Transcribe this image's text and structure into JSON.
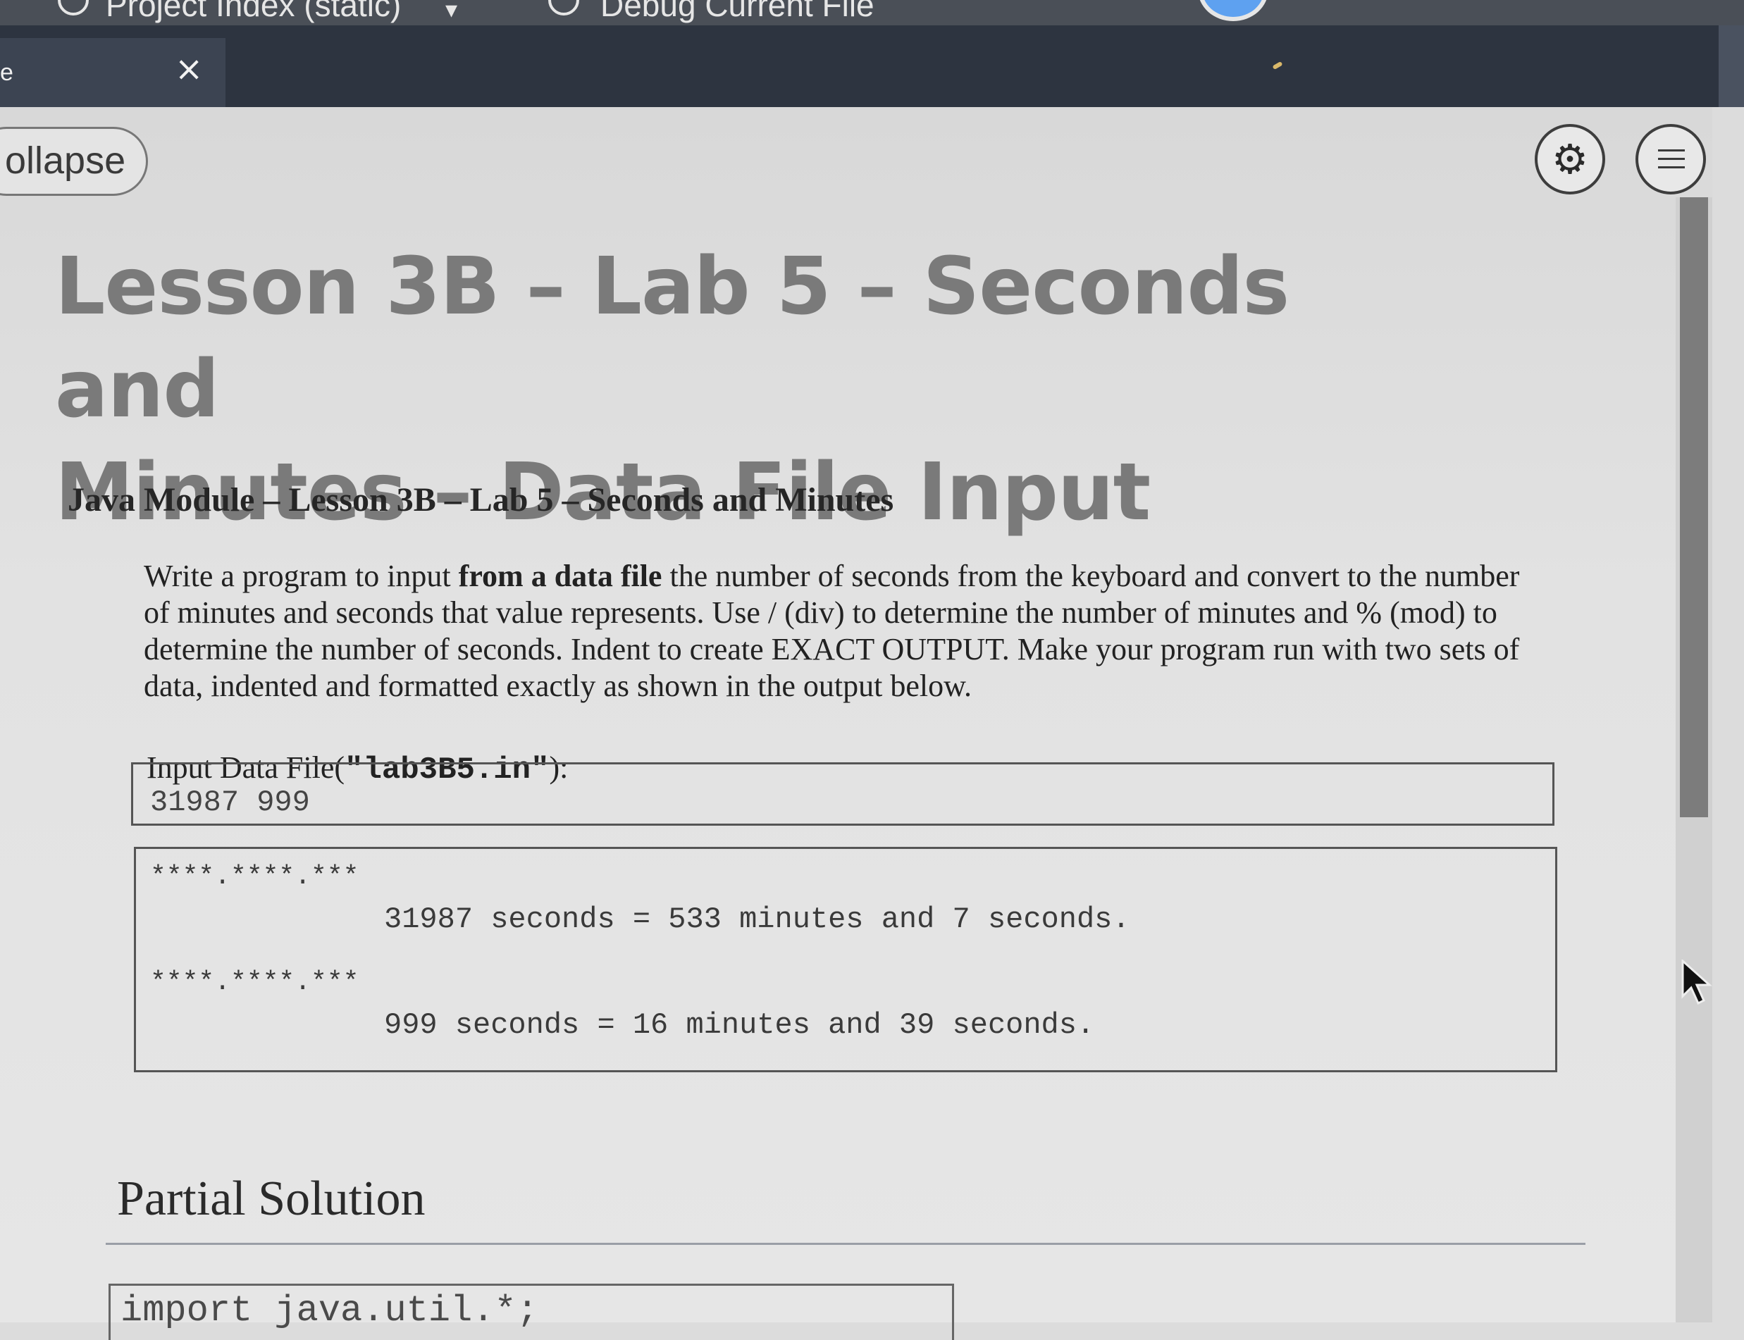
{
  "toolbar": {
    "project_index_label": "Project Index (static)",
    "debug_label": "Debug Current File",
    "globe_icon": "globe-icon",
    "debug_icon": "bug-icon",
    "dropdown_icon": "chevron-down-icon"
  },
  "tab": {
    "label": "e",
    "close_glyph": "×"
  },
  "controls": {
    "collapse_label": "ollapse",
    "gear_glyph": "⚙",
    "gear_icon": "gear-icon",
    "menu_icon": "list-icon"
  },
  "lesson": {
    "title_line1": "Lesson 3B – Lab 5 – Seconds and",
    "title_line2": "Minutes – Data File Input",
    "subtitle": "Java Module – Lesson 3B – Lab 5 – Seconds and Minutes",
    "description": {
      "part1": "Write a program to input ",
      "bold": "from a data file",
      "part2": " the number of seconds from the keyboard and convert to the number of minutes and seconds that value represents. Use / (div) to determine the number of minutes and % (mod) to determine the number of seconds. Indent to create EXACT OUTPUT. Make your program run with two sets of data, indented and formatted exactly as shown in the output below."
    }
  },
  "input_file": {
    "label_prefix": "Input Data File(",
    "file_name": "\"lab3B5.in\"",
    "label_suffix": "):",
    "contents": "31987 999"
  },
  "output": {
    "ruler1": "****.****.***",
    "line1": "31987 seconds = 533 minutes and 7 seconds.",
    "ruler2": "****.****.***",
    "line2": "999 seconds = 16 minutes and 39 seconds."
  },
  "partial_solution": {
    "heading": "Partial Solution",
    "code_first_line": "import java.util.*;"
  },
  "colors": {
    "toolbar_bg": "#4a4f57",
    "tabbar_bg": "#2d3440",
    "run_button": "#5ea1f0",
    "page_bg": "#e2e2e2",
    "title_text": "#7a7a7a"
  }
}
